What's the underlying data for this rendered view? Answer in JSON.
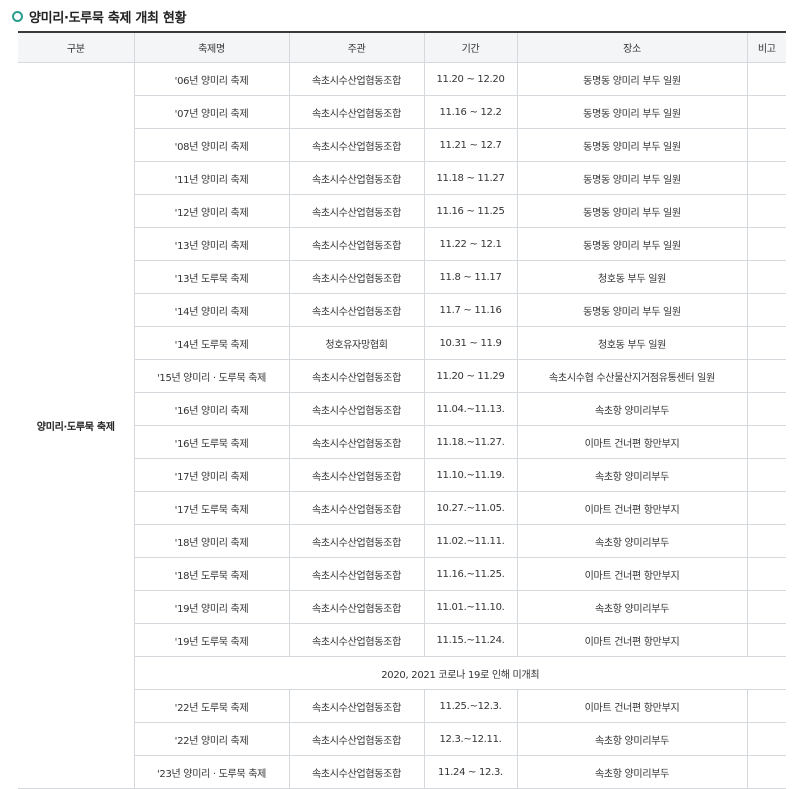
{
  "title": "양미리·도루묵 축제 개최 현황",
  "accent_color": "#2a9d8f",
  "headers": [
    "구분",
    "축제명",
    "주관",
    "기간",
    "장소",
    "비고"
  ],
  "category": "양미리·도루묵 축제",
  "rows": [
    {
      "name": "'06년 양미리 축제",
      "host": "속초시수산업협동조합",
      "period": "11.20 ~ 12.20",
      "place": "동명동 양미리 부두 일원",
      "note": ""
    },
    {
      "name": "'07년 양미리 축제",
      "host": "속초시수산업협동조합",
      "period": "11.16 ~ 12.2",
      "place": "동명동 양미리 부두 일원",
      "note": ""
    },
    {
      "name": "'08년 양미리 축제",
      "host": "속초시수산업협동조합",
      "period": "11.21 ~ 12.7",
      "place": "동명동 양미리 부두 일원",
      "note": ""
    },
    {
      "name": "'11년 양미리 축제",
      "host": "속초시수산업협동조합",
      "period": "11.18 ~ 11.27",
      "place": "동명동 양미리 부두 일원",
      "note": ""
    },
    {
      "name": "'12년 양미리 축제",
      "host": "속초시수산업협동조합",
      "period": "11.16 ~ 11.25",
      "place": "동명동 양미리 부두 일원",
      "note": ""
    },
    {
      "name": "'13년 양미리 축제",
      "host": "속초시수산업협동조합",
      "period": "11.22 ~ 12.1",
      "place": "동명동 양미리 부두 일원",
      "note": ""
    },
    {
      "name": "'13년 도루묵 축제",
      "host": "속초시수산업협동조합",
      "period": "11.8 ~ 11.17",
      "place": "청호동 부두 일원",
      "note": ""
    },
    {
      "name": "'14년 양미리 축제",
      "host": "속초시수산업협동조합",
      "period": "11.7 ~ 11.16",
      "place": "동명동 양미리 부두 일원",
      "note": ""
    },
    {
      "name": "'14년 도루묵 축제",
      "host": "청호유자망협회",
      "period": "10.31 ~ 11.9",
      "place": "청호동 부두 일원",
      "note": ""
    },
    {
      "name": "'15년 양미리 · 도루묵 축제",
      "host": "속초시수산업협동조합",
      "period": "11.20 ~ 11.29",
      "place": "속초시수협 수산물산지거점유통센터 일원",
      "note": ""
    },
    {
      "name": "'16년 양미리 축제",
      "host": "속초시수산업협동조합",
      "period": "11.04.~11.13.",
      "place": "속초항 양미리부두",
      "note": ""
    },
    {
      "name": "'16년 도루묵 축제",
      "host": "속초시수산업협동조합",
      "period": "11.18.~11.27.",
      "place": "이마트 건너편 항만부지",
      "note": ""
    },
    {
      "name": "'17년 양미리 축제",
      "host": "속초시수산업협동조합",
      "period": "11.10.~11.19.",
      "place": "속초항 양미리부두",
      "note": ""
    },
    {
      "name": "'17년 도루묵 축제",
      "host": "속초시수산업협동조합",
      "period": "10.27.~11.05.",
      "place": "이마트 건너편 항만부지",
      "note": ""
    },
    {
      "name": "'18년 양미리 축제",
      "host": "속초시수산업협동조합",
      "period": "11.02.~11.11.",
      "place": "속초항 양미리부두",
      "note": ""
    },
    {
      "name": "'18년 도루묵 축제",
      "host": "속초시수산업협동조합",
      "period": "11.16.~11.25.",
      "place": "이마트 건너편 항만부지",
      "note": ""
    },
    {
      "name": "'19년 양미리 축제",
      "host": "속초시수산업협동조합",
      "period": "11.01.~11.10.",
      "place": "속초항 양미리부두",
      "note": ""
    },
    {
      "name": "'19년 도루묵 축제",
      "host": "속초시수산업협동조합",
      "period": "11.15.~11.24.",
      "place": "이마트 건너편 항만부지",
      "note": ""
    },
    {
      "notice": "2020, 2021 코로나 19로 인해 미개최"
    },
    {
      "name": "'22년 도루묵 축제",
      "host": "속초시수산업협동조합",
      "period": "11.25.~12.3.",
      "place": "이마트 건너편 항만부지",
      "note": ""
    },
    {
      "name": "'22년 양미리 축제",
      "host": "속초시수산업협동조합",
      "period": "12.3.~12.11.",
      "place": "속초항 양미리부두",
      "note": ""
    },
    {
      "name": "'23년 양미리 · 도루묵 축제",
      "host": "속초시수산업협동조합",
      "period": "11.24 ~ 12.3.",
      "place": "속초항 양미리부두",
      "note": ""
    }
  ]
}
